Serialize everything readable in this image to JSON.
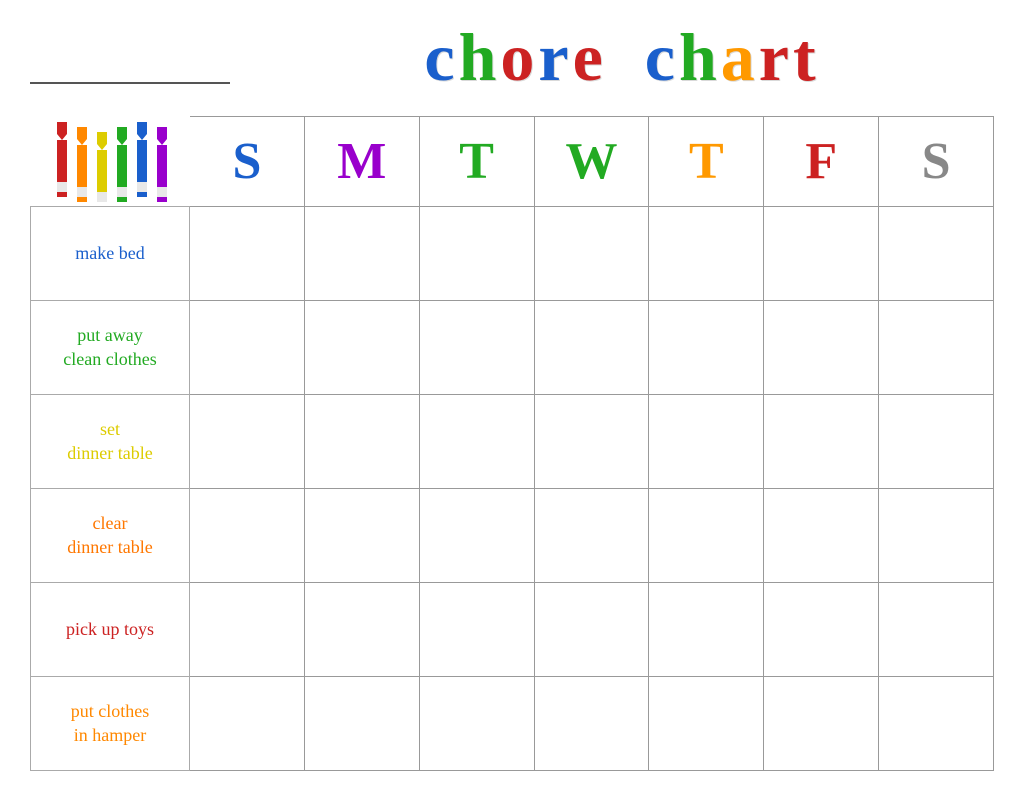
{
  "header": {
    "title_word1": "chore",
    "title_word2": "chart",
    "title_letters_word1": [
      "c",
      "h",
      "o",
      "r",
      "e"
    ],
    "title_colors_word1": [
      "#1a5fcc",
      "#22aa22",
      "#cc2222",
      "#1a5fcc",
      "#cc2222"
    ],
    "title_letters_word2": [
      "c",
      "h",
      "a",
      "r",
      "t"
    ],
    "title_colors_word2": [
      "#1a5fcc",
      "#22aa22",
      "#ff9900",
      "#cc2222",
      "#cc2222"
    ]
  },
  "days": {
    "headers": [
      {
        "label": "S",
        "color": "#1a5fcc"
      },
      {
        "label": "M",
        "color": "#9900cc"
      },
      {
        "label": "T",
        "color": "#22aa22"
      },
      {
        "label": "W",
        "color": "#22aa22"
      },
      {
        "label": "T",
        "color": "#ff9900"
      },
      {
        "label": "F",
        "color": "#cc2222"
      },
      {
        "label": "S",
        "color": "#888888"
      }
    ]
  },
  "chores": [
    {
      "text": "make bed",
      "color": "#1a5fcc"
    },
    {
      "text": "put away\nclean clothes",
      "color": "#22aa22"
    },
    {
      "text": "set\ndinner table",
      "color": "#ddcc00"
    },
    {
      "text": "clear\ndinner table",
      "color": "#ff7700"
    },
    {
      "text": "pick up toys",
      "color": "#cc2222"
    },
    {
      "text": "put clothes\nin hamper",
      "color": "#ff8800"
    }
  ],
  "crayons": [
    {
      "color": "#cc2222",
      "label_color": "#ffcccc"
    },
    {
      "color": "#ff8800",
      "label_color": "#ffe5cc"
    },
    {
      "color": "#ddcc00",
      "label_color": "#fffacc"
    },
    {
      "color": "#22aa22",
      "label_color": "#ccffcc"
    },
    {
      "color": "#1a5fcc",
      "label_color": "#cce0ff"
    },
    {
      "color": "#9900cc",
      "label_color": "#f0ccff"
    }
  ]
}
